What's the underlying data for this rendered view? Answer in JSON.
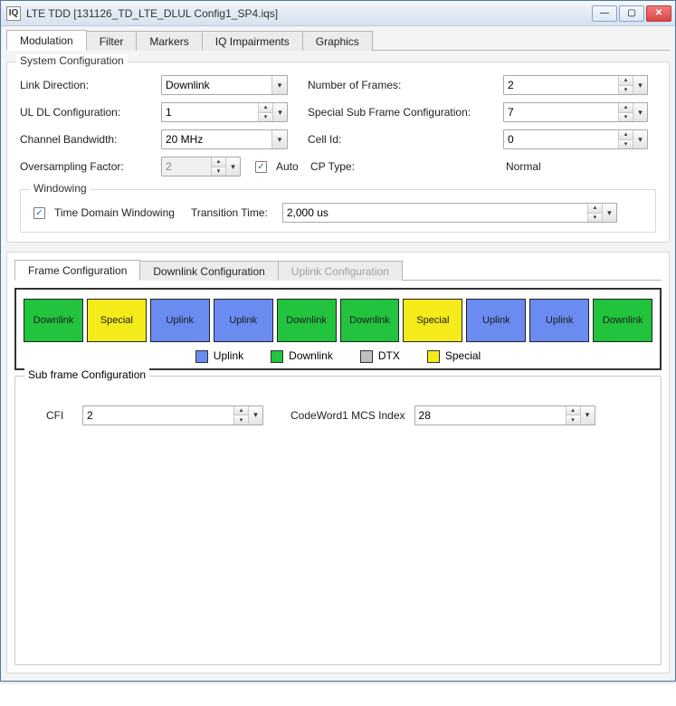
{
  "window": {
    "app_icon_text": "IQ",
    "title": "LTE TDD [131126_TD_LTE_DLUL Config1_SP4.iqs]"
  },
  "main_tabs": [
    {
      "label": "Modulation",
      "active": true
    },
    {
      "label": "Filter",
      "active": false
    },
    {
      "label": "Markers",
      "active": false
    },
    {
      "label": "IQ Impairments",
      "active": false
    },
    {
      "label": "Graphics",
      "active": false
    }
  ],
  "system_config": {
    "title": "System Configuration",
    "labels": {
      "link_direction": "Link Direction:",
      "ul_dl_config": "UL DL Configuration:",
      "channel_bw": "Channel Bandwidth:",
      "oversampling": "Oversampling Factor:",
      "auto": "Auto",
      "num_frames": "Number of Frames:",
      "special_sub": "Special Sub Frame Configuration:",
      "cell_id": "Cell Id:",
      "cp_type": "CP Type:"
    },
    "values": {
      "link_direction": "Downlink",
      "ul_dl_config": "1",
      "channel_bw": "20 MHz",
      "oversampling": "2",
      "auto_checked": true,
      "num_frames": "2",
      "special_sub": "7",
      "cell_id": "0",
      "cp_type": "Normal"
    },
    "windowing": {
      "title": "Windowing",
      "td_windowing_checked": true,
      "td_windowing_label": "Time Domain Windowing",
      "transition_time_label": "Transition Time:",
      "transition_time_value": "2,000 us"
    }
  },
  "sub_tabs": [
    {
      "label": "Frame Configuration",
      "active": true,
      "disabled": false
    },
    {
      "label": "Downlink Configuration",
      "active": false,
      "disabled": false
    },
    {
      "label": "Uplink Configuration",
      "active": false,
      "disabled": true
    }
  ],
  "frames": [
    {
      "label": "Downlink",
      "type": "downlink"
    },
    {
      "label": "Special",
      "type": "special"
    },
    {
      "label": "Uplink",
      "type": "uplink"
    },
    {
      "label": "Uplink",
      "type": "uplink"
    },
    {
      "label": "Downlink",
      "type": "downlink"
    },
    {
      "label": "Downlink",
      "type": "downlink"
    },
    {
      "label": "Special",
      "type": "special"
    },
    {
      "label": "Uplink",
      "type": "uplink"
    },
    {
      "label": "Uplink",
      "type": "uplink"
    },
    {
      "label": "Downlink",
      "type": "downlink"
    }
  ],
  "frame_legend": {
    "uplink": {
      "label": "Uplink",
      "color": "#6a8cf0"
    },
    "downlink": {
      "label": "Downlink",
      "color": "#22c33d"
    },
    "dtx": {
      "label": "DTX",
      "color": "#bfbfbf"
    },
    "special": {
      "label": "Special",
      "color": "#f5eb1a"
    }
  },
  "subframe_config": {
    "title": "Sub frame Configuration",
    "cfi_label": "CFI",
    "cfi_value": "2",
    "cw1_label": "CodeWord1 MCS Index",
    "cw1_value": "28"
  }
}
